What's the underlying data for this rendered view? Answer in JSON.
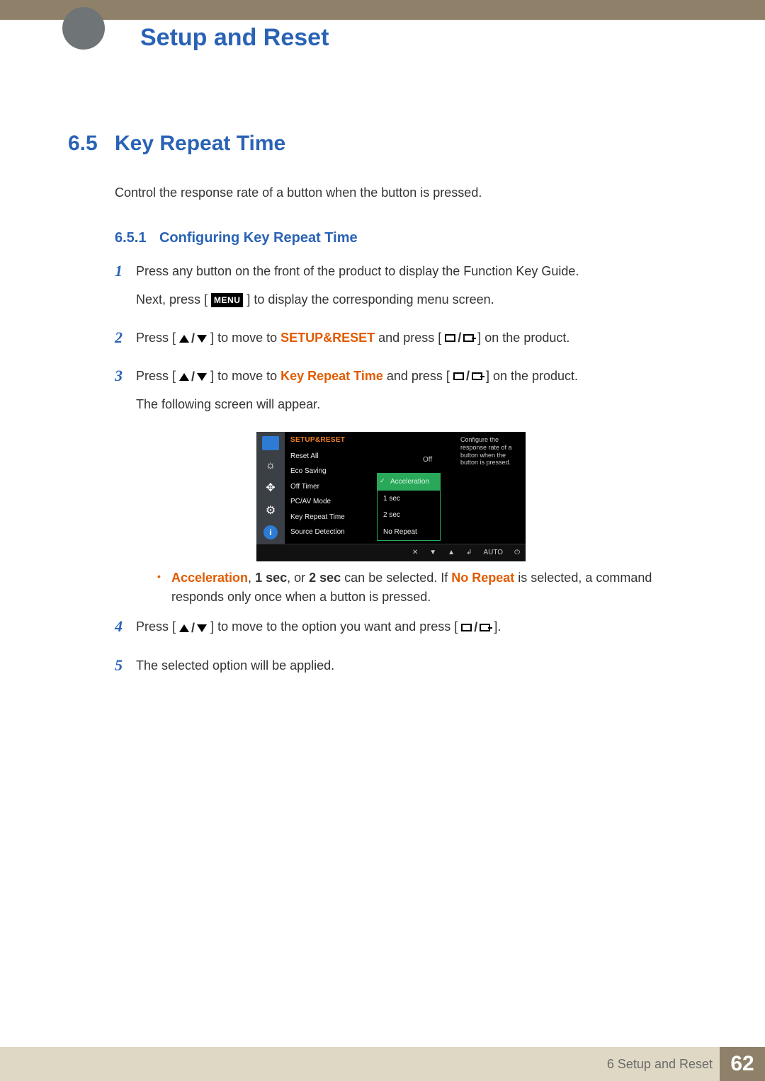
{
  "chapter_title": "Setup and Reset",
  "section": {
    "number": "6.5",
    "title": "Key Repeat Time",
    "intro": "Control the response rate of a button when the button is pressed."
  },
  "subsection": {
    "number": "6.5.1",
    "title": "Configuring Key Repeat Time"
  },
  "menu_label": "MENU",
  "steps": {
    "s1": {
      "num": "1",
      "line1": "Press any button on the front of the product to display the Function Key Guide.",
      "line2a": "Next, press [",
      "line2b": "] to display the corresponding menu screen."
    },
    "s2": {
      "num": "2",
      "pre": "Press [",
      "mid1": "] to move to ",
      "target": "SETUP&RESET",
      "mid2": " and press [",
      "post": "] on the product."
    },
    "s3": {
      "num": "3",
      "pre": "Press [",
      "mid1": "] to move to ",
      "target": "Key Repeat Time",
      "mid2": " and press [",
      "post": "] on the product.",
      "tail": "The following screen will appear."
    },
    "s4": {
      "num": "4",
      "pre": "Press [",
      "mid": "] to move to the option you want and press [",
      "post": "]."
    },
    "s5": {
      "num": "5",
      "text": "The selected option will be applied."
    }
  },
  "osd": {
    "header": "SETUP&RESET",
    "left": [
      "Reset All",
      "Eco Saving",
      "Off Timer",
      "PC/AV Mode",
      "Key Repeat Time",
      "Source Detection"
    ],
    "eco_value": "Off",
    "popup": [
      "Acceleration",
      "1 sec",
      "2 sec",
      "No Repeat"
    ],
    "help": "Configure the response rate of a button when the button is pressed.",
    "footer_auto": "AUTO"
  },
  "note": {
    "accel": "Acceleration",
    "sep1": ", ",
    "one": "1 sec",
    "sep2": ", or ",
    "two": "2 sec",
    "mid": " can be selected. If ",
    "norep": "No Repeat",
    "tail": " is selected, a command responds only once when a button is pressed."
  },
  "footer": {
    "label": "6 Setup and Reset",
    "page": "62"
  }
}
